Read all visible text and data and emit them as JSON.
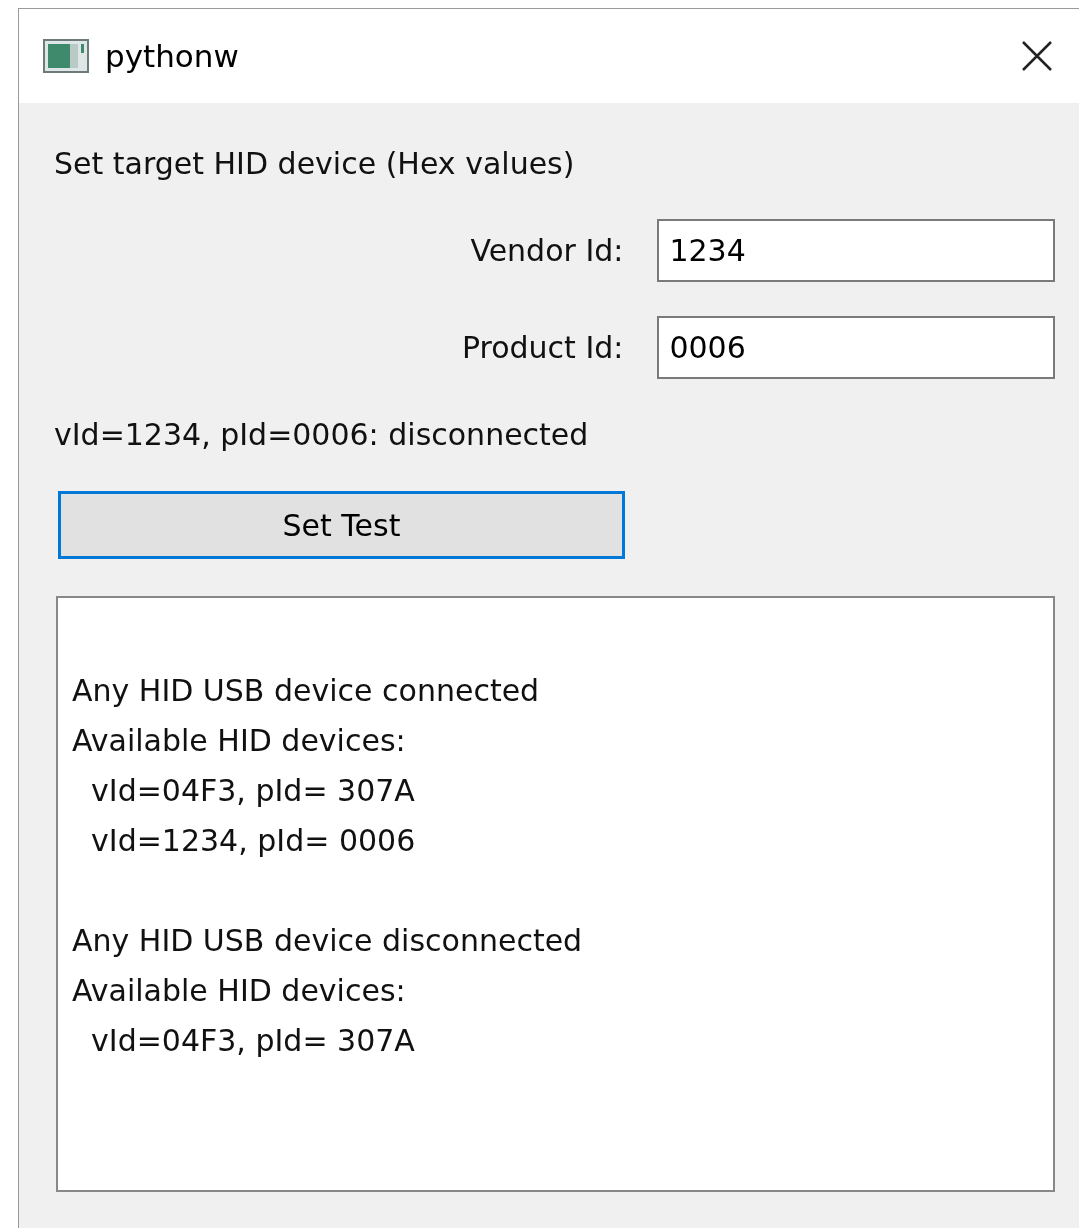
{
  "window": {
    "title": "pythonw"
  },
  "heading": "Set target HID device (Hex values)",
  "fields": [
    {
      "label": "Vendor Id:",
      "value": "1234"
    },
    {
      "label": "Product Id:",
      "value": "0006"
    }
  ],
  "status": "vId=1234, pId=0006: disconnected",
  "button": {
    "label": "Set Test",
    "focused": true
  },
  "log": [
    {
      "lines": [
        "Any HID USB device connected",
        "Available HID devices:",
        "  vId=04F3, pId= 307A",
        "  vId=1234, pId= 0006"
      ]
    },
    {
      "lines": [
        "Any HID USB device disconnected",
        "Available HID devices:",
        "  vId=04F3, pId= 307A"
      ]
    }
  ]
}
